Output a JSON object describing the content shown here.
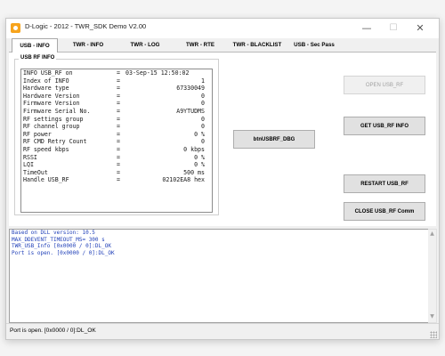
{
  "window": {
    "title": "D-Logic - 2012 - TWR_SDK Demo V2.00",
    "controls": {
      "minimize": "—",
      "maximize": "☐",
      "close": "✕"
    }
  },
  "tabs": [
    {
      "label": "USB - INFO",
      "active": true
    },
    {
      "label": "TWR - INFO",
      "active": false
    },
    {
      "label": "TWR - LOG",
      "active": false
    },
    {
      "label": "TWR - RTE",
      "active": false
    },
    {
      "label": "TWR - BLACKLIST",
      "active": false
    },
    {
      "label": "USB - Sec Pass",
      "active": false
    }
  ],
  "usb_rf_info": {
    "group_title": "USB RF INFO",
    "rows": [
      {
        "label": "INFO USB_RF on",
        "value": "03-Sep-15 12:50:02"
      },
      {
        "label": "Index of INFO",
        "value": "1"
      },
      {
        "label": "Hardware type",
        "value": "67330049"
      },
      {
        "label": "Hardware Version",
        "value": "0"
      },
      {
        "label": "Firmware Version",
        "value": "0"
      },
      {
        "label": "Firmware Serial No.",
        "value": "A9YTUDMS"
      },
      {
        "label": "RF settings group",
        "value": "0"
      },
      {
        "label": "RF channel group",
        "value": "0"
      },
      {
        "label": "RF power",
        "value": "0 %"
      },
      {
        "label": "RF CMD Retry Count",
        "value": "0"
      },
      {
        "label": "RF speed kbps",
        "value": "0 kbps"
      },
      {
        "label": "RSSI",
        "value": "0 %"
      },
      {
        "label": "LQI",
        "value": "0 %"
      },
      {
        "label": "TimeOut",
        "value": "500 ms"
      },
      {
        "label": "Handle USB_RF",
        "value": "02102EA8 hex"
      }
    ]
  },
  "buttons": {
    "open": "OPEN USB_RF",
    "debug": "btnUSBRF_DBG",
    "get_info": "GET USB_RF INFO",
    "restart": "RESTART USB_RF",
    "close": "CLOSE USB_RF Comm"
  },
  "log": {
    "lines": [
      "Based on DLL version: 10.5",
      "MAX_DDEVENT_TIMEOUT_MS= 300 s",
      "TWR_USB_Info [0x0000 / 0]:DL_OK",
      "Port is open. [0x0000 / 0]:DL_OK"
    ]
  },
  "status_bar": {
    "text": "Port is open. [0x0000 / 0]:DL_OK"
  }
}
